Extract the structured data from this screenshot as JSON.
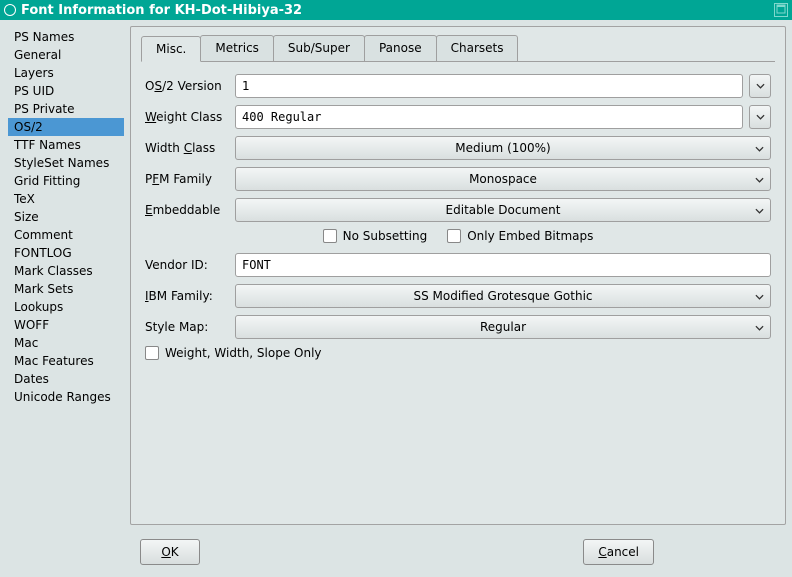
{
  "title": "Font Information for KH-Dot-Hibiya-32",
  "sidebar": {
    "items": [
      {
        "label": "PS Names"
      },
      {
        "label": "General"
      },
      {
        "label": "Layers"
      },
      {
        "label": "PS UID"
      },
      {
        "label": "PS Private"
      },
      {
        "label": "OS/2"
      },
      {
        "label": "TTF Names"
      },
      {
        "label": "StyleSet Names"
      },
      {
        "label": "Grid Fitting"
      },
      {
        "label": "TeX"
      },
      {
        "label": "Size"
      },
      {
        "label": "Comment"
      },
      {
        "label": "FONTLOG"
      },
      {
        "label": "Mark Classes"
      },
      {
        "label": "Mark Sets"
      },
      {
        "label": "Lookups"
      },
      {
        "label": "WOFF"
      },
      {
        "label": "Mac"
      },
      {
        "label": "Mac Features"
      },
      {
        "label": "Dates"
      },
      {
        "label": "Unicode Ranges"
      }
    ],
    "selected_index": 5
  },
  "tabs": {
    "items": [
      "Misc.",
      "Metrics",
      "Sub/Super",
      "Panose",
      "Charsets"
    ],
    "active_index": 0
  },
  "form": {
    "os2_version_label_pre": "O",
    "os2_version_label_ul": "S",
    "os2_version_label_post": "/2 Version",
    "os2_version_value": "1",
    "weight_label_ul": "W",
    "weight_label_post": "eight Class",
    "weight_value": "400 Regular",
    "width_label_pre": "Width ",
    "width_label_ul": "C",
    "width_label_post": "lass",
    "width_value": "Medium (100%)",
    "pfm_label_pre": "P",
    "pfm_label_ul": "F",
    "pfm_label_post": "M Family",
    "pfm_value": "Monospace",
    "embed_label_ul": "E",
    "embed_label_post": "mbeddable",
    "embed_value": "Editable Document",
    "no_subsetting_label": "No Subsetting",
    "only_bitmaps_label": "Only Embed Bitmaps",
    "vendor_label": "Vendor ID:",
    "vendor_value": "FONT",
    "ibm_label_ul": "I",
    "ibm_label_post": "BM Family:",
    "ibm_value": "SS Modified Grotesque Gothic",
    "stylemap_label": "Style Map:",
    "stylemap_value": "Regular",
    "wws_label": "Weight, Width, Slope Only"
  },
  "buttons": {
    "ok_ul": "O",
    "ok_post": "K",
    "cancel_ul": "C",
    "cancel_post": "ancel"
  }
}
